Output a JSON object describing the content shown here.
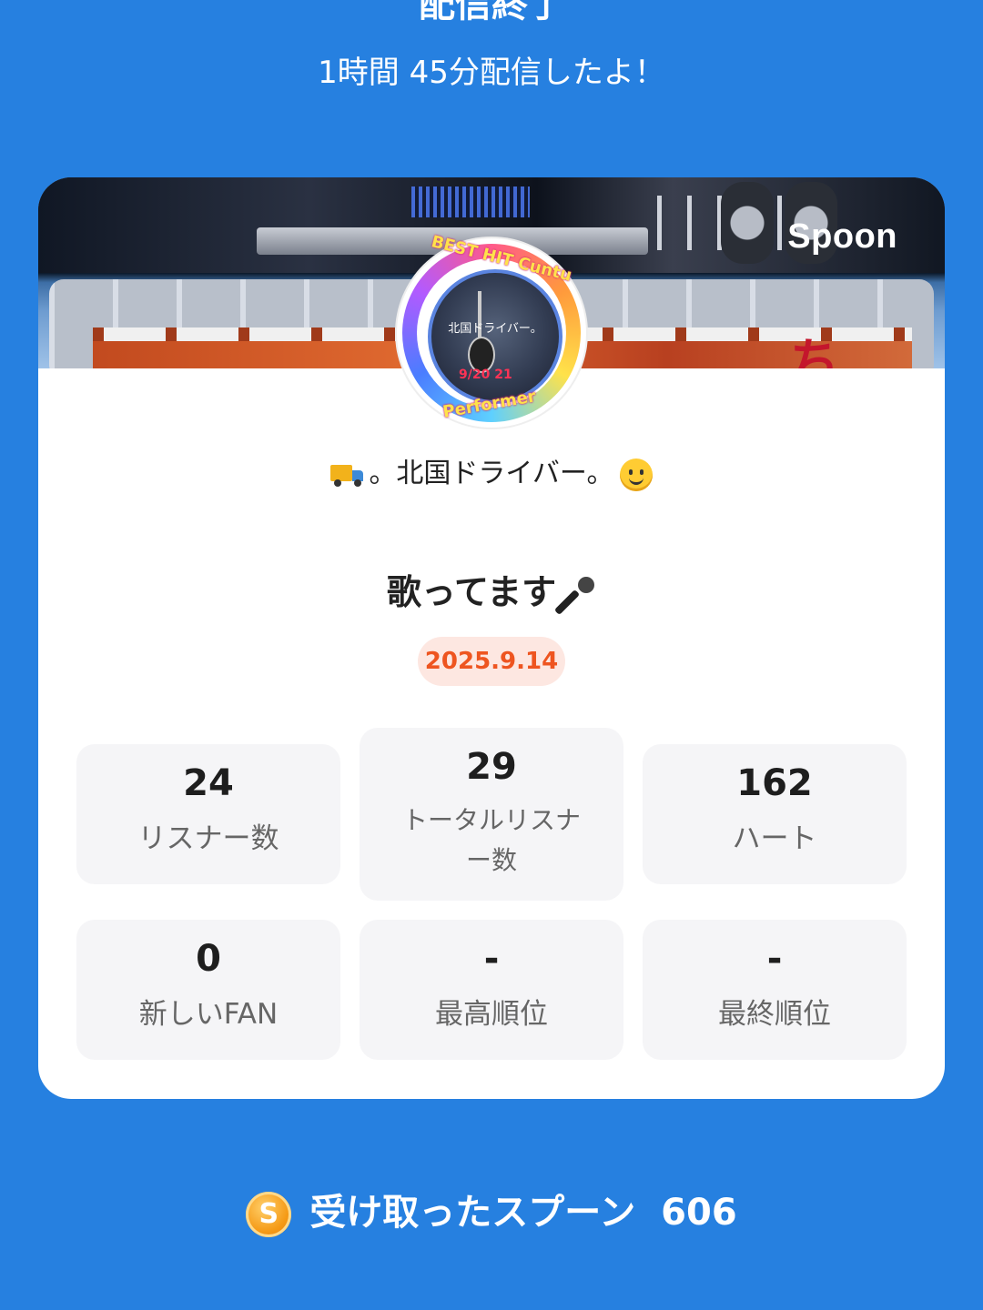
{
  "top_text": "配信終了",
  "duration_text": "1時間 45分配信したよ！",
  "card": {
    "brand": "Spoon",
    "banner_char": "ち",
    "avatar": {
      "top_text": "BEST HIT Cuntu",
      "bottom_text": "Performer",
      "center_label": "北国ドライバー。",
      "date": "9/20 21"
    },
    "username": "。北国ドライバー。",
    "title": "歌ってます",
    "date": "2025.9.14",
    "stats": [
      {
        "value": "24",
        "label": "リスナー数"
      },
      {
        "value": "29",
        "label": "トータルリスナー数"
      },
      {
        "value": "162",
        "label": "ハート"
      },
      {
        "value": "0",
        "label": "新しいFAN"
      },
      {
        "value": "-",
        "label": "最高順位"
      },
      {
        "value": "-",
        "label": "最終順位"
      }
    ]
  },
  "spoon": {
    "coin": "S",
    "label": "受け取ったスプーン",
    "value": "606"
  },
  "colors": {
    "background": "#2680e0",
    "date_text": "#ee5520",
    "date_bg": "#fde7e1"
  }
}
